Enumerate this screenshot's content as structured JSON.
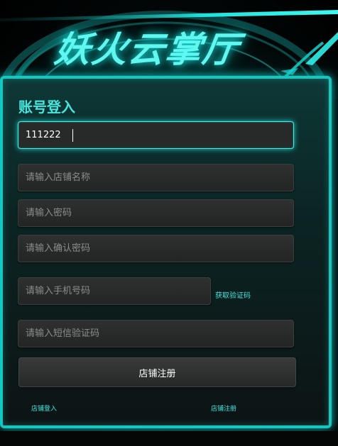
{
  "app": {
    "title": "妖火云掌厅"
  },
  "form": {
    "heading": "账号登入",
    "account": {
      "value": "111222",
      "placeholder": ""
    },
    "shop_name": {
      "value": "",
      "placeholder": "请输入店铺名称"
    },
    "password": {
      "value": "",
      "placeholder": "请输入密码"
    },
    "confirm_password": {
      "value": "",
      "placeholder": "请输入确认密码"
    },
    "phone": {
      "value": "",
      "placeholder": "请输入手机号码"
    },
    "get_code_label": "获取验证码",
    "sms_code": {
      "value": "",
      "placeholder": "请输入短信验证码"
    },
    "submit_label": "店铺注册"
  },
  "footer": {
    "login_link": "店铺登入",
    "register_link": "店铺注册"
  },
  "colors": {
    "accent": "#3fe6df",
    "panel_border": "#14c8c2",
    "title_glow": "#5ff7f0"
  }
}
